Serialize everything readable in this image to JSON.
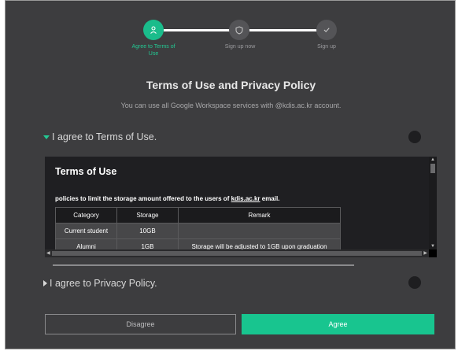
{
  "stepper": {
    "steps": [
      {
        "label_line1": "Agree to Terms of",
        "label_line2": "Use",
        "icon": "person-icon",
        "state": "active"
      },
      {
        "label_line1": "Sign up now",
        "label_line2": "",
        "icon": "shield-icon",
        "state": "inactive"
      },
      {
        "label_line1": "Sign up",
        "label_line2": "",
        "icon": "check-icon",
        "state": "inactive"
      }
    ]
  },
  "header": {
    "title": "Terms of Use and Privacy Policy",
    "subtitle": "You can use all Google Workspace services with @kdis.ac.kr account."
  },
  "terms_section": {
    "label": "I agree to Terms of Use.",
    "expanded": true,
    "content": {
      "heading": "Terms of Use",
      "policy_prefix": "policies to limit the storage amount offered to the users of ",
      "policy_domain": "kdis.ac.kr",
      "policy_suffix": " email.",
      "table": {
        "headers": [
          "Category",
          "Storage",
          "Remark"
        ],
        "rows": [
          [
            "Current student",
            "10GB",
            ""
          ],
          [
            "Alumni",
            "1GB",
            "Storage will be adjusted to 1GB upon graduation"
          ]
        ]
      }
    }
  },
  "privacy_section": {
    "label": "I agree to Privacy Policy.",
    "expanded": false
  },
  "buttons": {
    "disagree": "Disagree",
    "agree": "Agree"
  },
  "colors": {
    "accent": "#1abc8b",
    "background": "#3d3d3f",
    "panel": "#1f1f22"
  }
}
